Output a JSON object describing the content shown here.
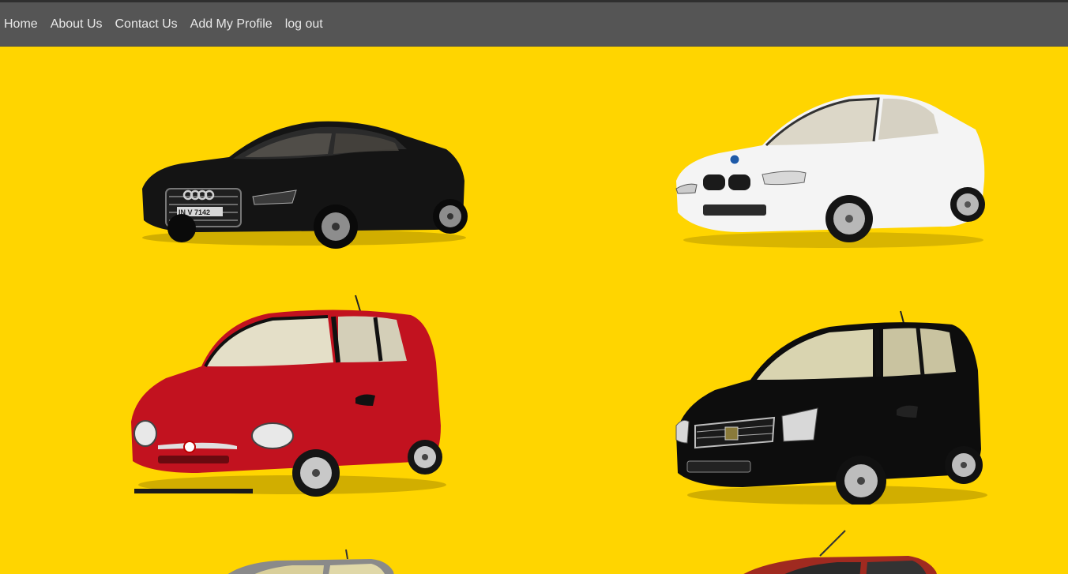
{
  "nav": {
    "items": [
      {
        "label": "Home"
      },
      {
        "label": "About Us"
      },
      {
        "label": "Contact Us"
      },
      {
        "label": "Add My Profile"
      },
      {
        "label": "log out"
      }
    ]
  },
  "gallery": {
    "background_color": "#ffd500",
    "cars": [
      {
        "name": "black-sedan",
        "body_color": "#141414",
        "plate": "IN V 7142"
      },
      {
        "name": "white-coupe",
        "body_color": "#f4f4f4"
      },
      {
        "name": "red-hatchback",
        "body_color": "#c2121f"
      },
      {
        "name": "black-suv",
        "body_color": "#0d0d0d"
      },
      {
        "name": "silver-car-partial",
        "body_color": "#8a8a8a"
      },
      {
        "name": "red-car-partial",
        "body_color": "#a02a20"
      }
    ]
  }
}
